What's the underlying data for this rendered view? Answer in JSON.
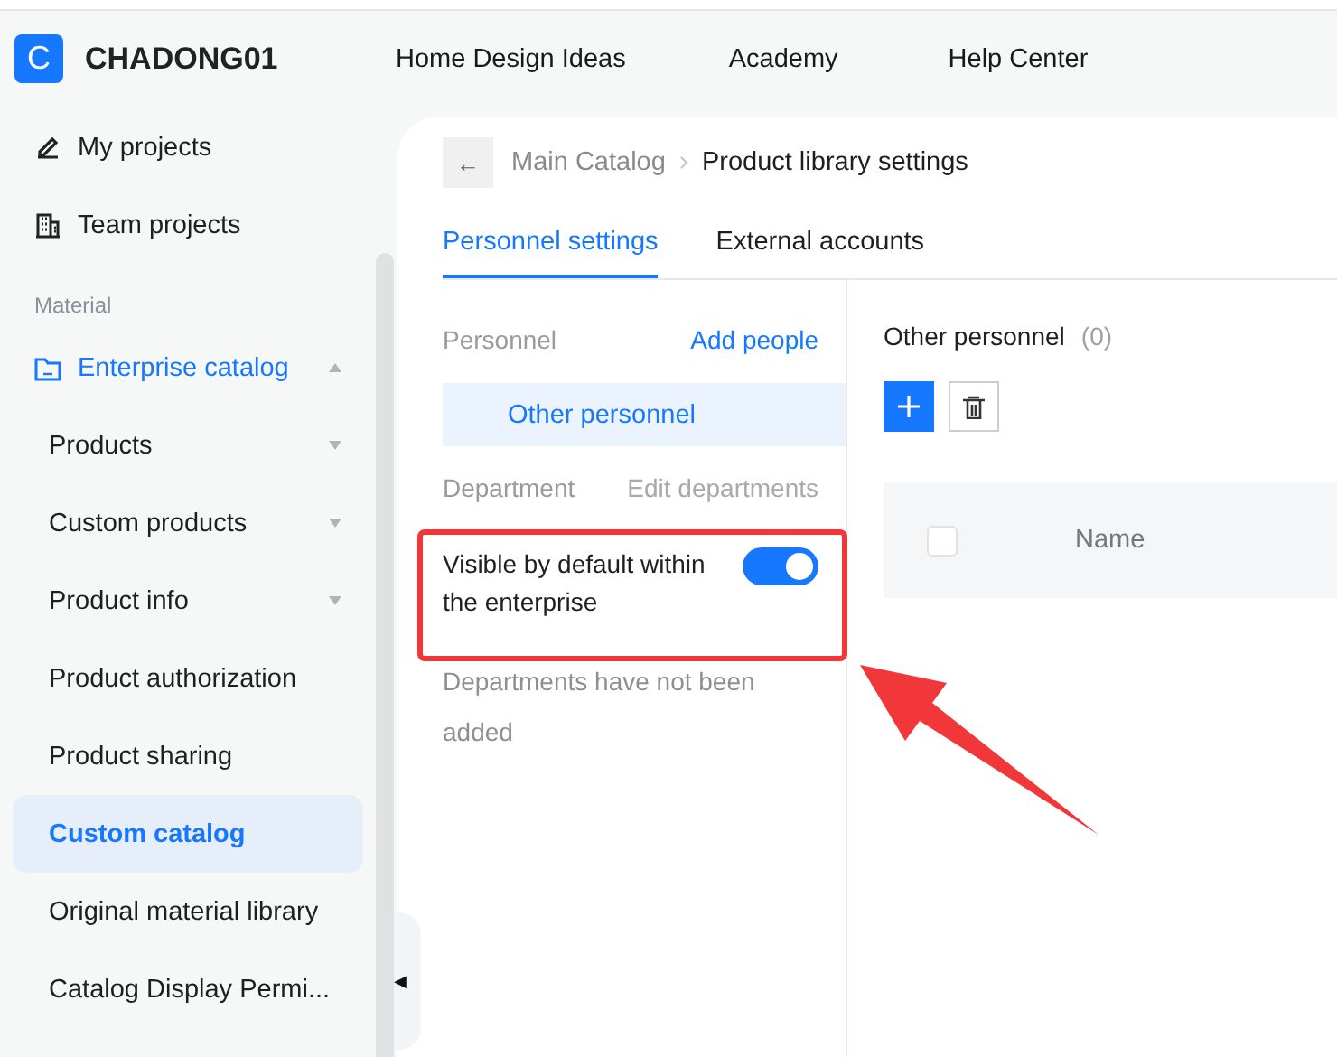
{
  "header": {
    "logo": "C",
    "brand": "CHADONG01",
    "nav": [
      {
        "label": "Home Design Ideas"
      },
      {
        "label": "Academy"
      },
      {
        "label": "Help Center"
      }
    ]
  },
  "sidebar": {
    "items": [
      {
        "kind": "link",
        "label": "My projects"
      },
      {
        "kind": "link",
        "label": "Team projects"
      },
      {
        "kind": "section",
        "label": "Material"
      },
      {
        "kind": "group",
        "label": "Enterprise catalog",
        "expanded": true
      },
      {
        "kind": "sub",
        "label": "Products",
        "expanded": false,
        "selected": false
      },
      {
        "kind": "sub",
        "label": "Custom products",
        "expanded": false,
        "selected": false
      },
      {
        "kind": "sub",
        "label": "Product info",
        "expanded": false,
        "selected": false
      },
      {
        "kind": "sub",
        "label": "Product authorization",
        "selected": false
      },
      {
        "kind": "sub",
        "label": "Product sharing",
        "selected": false
      },
      {
        "kind": "sub",
        "label": "Custom catalog",
        "selected": true
      },
      {
        "kind": "sub",
        "label": "Original material library",
        "selected": false
      },
      {
        "kind": "sub",
        "label": "Catalog Display Permi...",
        "selected": false
      }
    ],
    "toggle": "◀"
  },
  "breadcrumb": {
    "back": "←",
    "items": [
      "Main Catalog",
      "Product library settings"
    ]
  },
  "tabs": [
    {
      "label": "Personnel settings",
      "selected": true
    },
    {
      "label": "External accounts",
      "selected": false
    }
  ],
  "personnel": {
    "title": "Personnel",
    "action": "Add people",
    "groups": [
      {
        "label": "Other personnel",
        "selected": true
      }
    ]
  },
  "department": {
    "title": "Department",
    "action": "Edit departments",
    "action_disabled": true,
    "visibility": {
      "label": "Visible by default within the enterprise",
      "on": true
    },
    "empty_note": "Departments have not been added"
  },
  "members": {
    "title": "Other personnel",
    "count": "(0)",
    "table": {
      "select_all_checked": false,
      "columns": [
        {
          "label": "Name"
        }
      ]
    }
  }
}
